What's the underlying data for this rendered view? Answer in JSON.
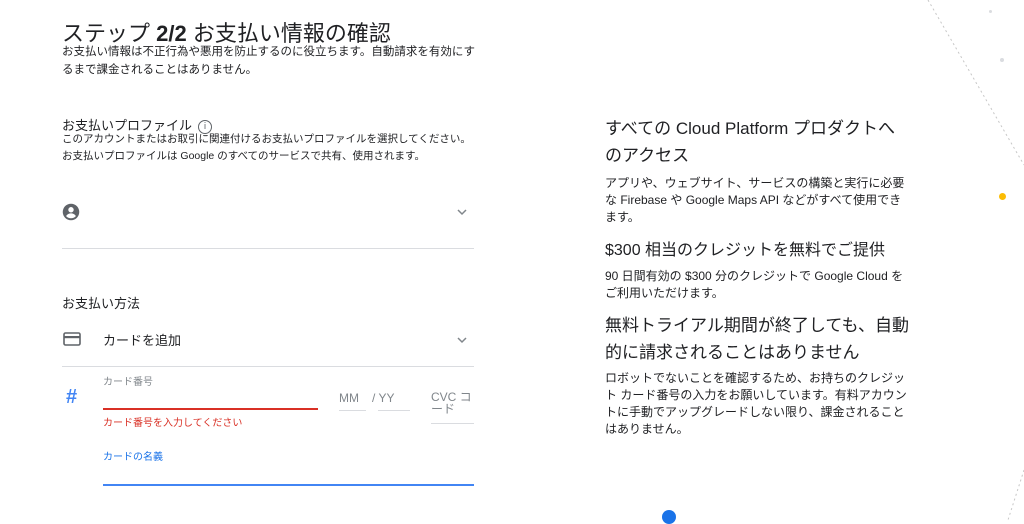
{
  "header": {
    "title_prefix": "ステップ ",
    "title_step": "2/2",
    "title_suffix": " お支払い情報の確認",
    "subtitle": "お支払い情報は不正行為や悪用を防止するのに役立ちます。自動請求を有効にするまで課金されることはありません。"
  },
  "profile": {
    "label": "お支払いプロファイル",
    "info_icon": "info-icon",
    "description": "このアカウントまたはお取引に関連付けるお支払いプロファイルを選択してください。お支払いプロファイルは Google のすべてのサービスで共有、使用されます。"
  },
  "payment": {
    "label": "お支払い方法",
    "method": "カードを追加",
    "card_number_label": "カード番号",
    "card_number_error": "カード番号を入力してください",
    "month_placeholder": "MM",
    "year_placeholder": "/ YY",
    "cvc_placeholder": "CVC コード",
    "card_name_label": "カードの名義"
  },
  "benefits": {
    "heading1": "すべての Cloud Platform プロダクトへのアクセス",
    "text1": "アプリや、ウェブサイト、サービスの構築と実行に必要な Firebase や Google Maps API などがすべて使用できます。",
    "heading2": "$300 相当のクレジットを無料でご提供",
    "text2": "90 日間有効の $300 分のクレジットで Google Cloud をご利用いただけます。",
    "heading3": "無料トライアル期間が終了しても、自動的に請求されることはありません",
    "text3": "ロボットでないことを確認するため、お持ちのクレジット カード番号の入力をお願いしています。有料アカウントに手動でアップグレードしない限り、課金されることはありません。"
  },
  "colors": {
    "error": "#d93025",
    "accent_blue": "#4285f4",
    "orange_dot": "#fbbc04"
  }
}
